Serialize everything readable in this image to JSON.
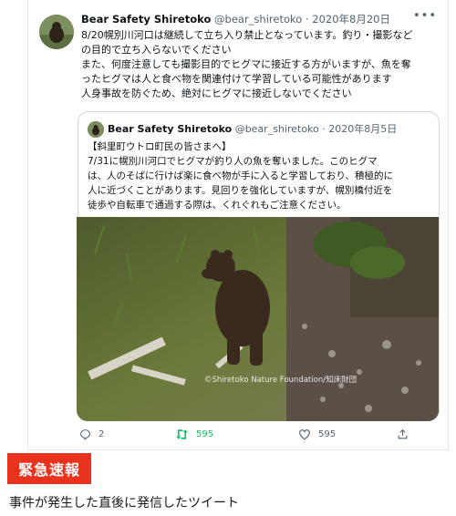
{
  "tweet": {
    "display_name": "Bear Safety Shiretoko",
    "handle": "@bear_shiretoko",
    "separator": "·",
    "date": "2020年8月20日",
    "body_lines": [
      "8/20幌別川河口は継続して立ち入り禁止となっています。釣り・撮影など",
      "の目的で立ち入らないでください",
      "また、何度注意しても撮影目的でヒグマに接近する方がいますが、魚を奪",
      "ったヒグマは人と食べ物を関連付けて学習している可能性があります",
      "人身事故を防ぐため、絶対にヒグマに接近しないでください"
    ]
  },
  "quote": {
    "display_name": "Bear Safety Shiretoko",
    "handle": "@bear_shiretoko",
    "separator": "·",
    "date": "2020年8月5日",
    "body_lines": [
      "【斜里町ウトロ町民の皆さまへ】",
      "7/31に幌別川河口でヒグマが釣り人の魚を奪いました。このヒグマ",
      "は、人のそばに行けば楽に食べ物が手に入ると学習しており、積極的に",
      "人に近づくことがあります。見回りを強化していますが、幌別橋付近を",
      "徒歩や自転車で通過する際は、くれぐれもご注意ください。"
    ],
    "photo_credit": "©Shiretoko Nature Foundation/知床財団"
  },
  "actions": {
    "reply_count": "2",
    "retweet_count": "595",
    "like_count": "595"
  },
  "badge_label": "緊急速報",
  "caption": "事件が発生した直後に発信したツイート",
  "colors": {
    "badge": "#e8321e",
    "retweet": "#17bf63",
    "muted": "#536471"
  }
}
